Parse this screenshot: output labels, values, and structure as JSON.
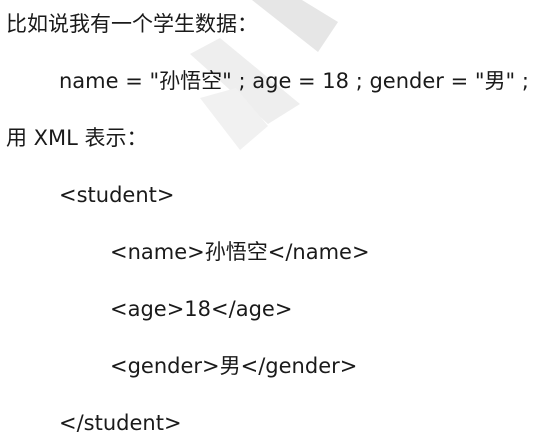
{
  "document": {
    "lines": [
      "比如说我有一个学生数据：",
      "name = \"孙悟空\" ; age = 18 ; gender = \"男\" ;",
      "用 XML 表示：",
      "<student>",
      "<name>孙悟空</name>",
      "<age>18</age>",
      "<gender>男</gender>",
      "</student>"
    ]
  }
}
